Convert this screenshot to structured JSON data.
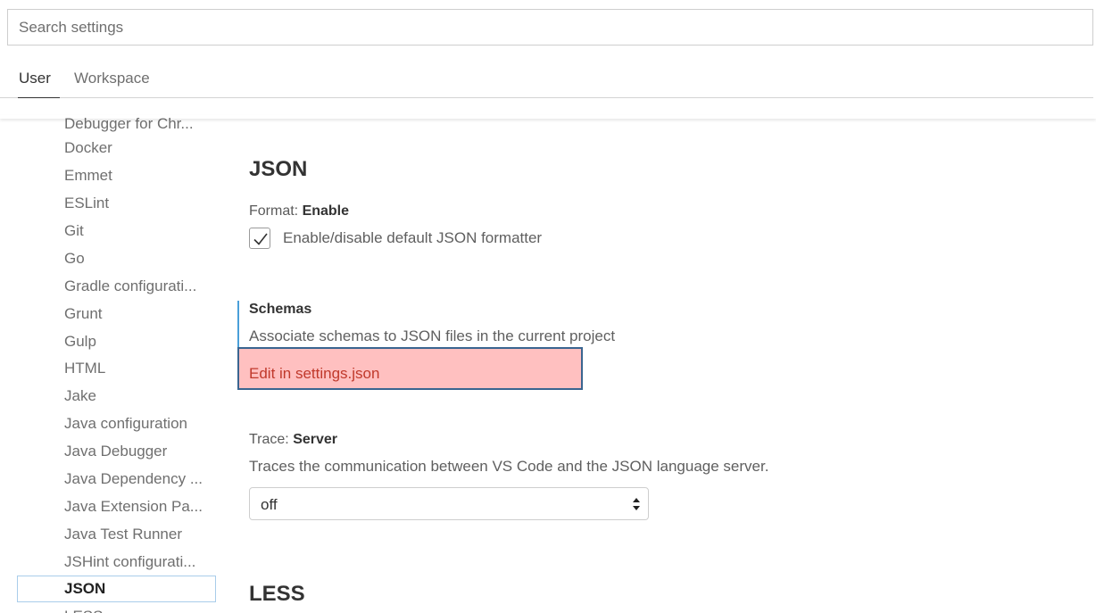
{
  "search": {
    "placeholder": "Search settings"
  },
  "tabs": [
    {
      "label": "User",
      "active": true
    },
    {
      "label": "Workspace",
      "active": false
    }
  ],
  "toc": {
    "items": [
      {
        "label": "Debugger for Chr..."
      },
      {
        "label": "Docker"
      },
      {
        "label": "Emmet"
      },
      {
        "label": "ESLint"
      },
      {
        "label": "Git"
      },
      {
        "label": "Go"
      },
      {
        "label": "Gradle configurati..."
      },
      {
        "label": "Grunt"
      },
      {
        "label": "Gulp"
      },
      {
        "label": "HTML"
      },
      {
        "label": "Jake"
      },
      {
        "label": "Java configuration"
      },
      {
        "label": "Java Debugger"
      },
      {
        "label": "Java Dependency ..."
      },
      {
        "label": "Java Extension Pa..."
      },
      {
        "label": "Java Test Runner"
      },
      {
        "label": "JSHint configurati..."
      },
      {
        "label": "JSON",
        "selected": true
      },
      {
        "label": "LESS"
      }
    ]
  },
  "content": {
    "json_title": "JSON",
    "format": {
      "label_prefix": "Format: ",
      "label_name": "Enable",
      "description": "Enable/disable default JSON formatter",
      "checked": true
    },
    "schemas": {
      "label": "Schemas",
      "description": "Associate schemas to JSON files in the current project",
      "link": "Edit in settings.json"
    },
    "trace": {
      "label_prefix": "Trace: ",
      "label_name": "Server",
      "description": "Traces the communication between VS Code and the JSON language server.",
      "value": "off"
    },
    "less_title": "LESS"
  },
  "colors": {
    "focus_bar": "#4a9fd9",
    "highlight": "#ffc0c0",
    "toc_selected_border": "#a9cdea"
  }
}
